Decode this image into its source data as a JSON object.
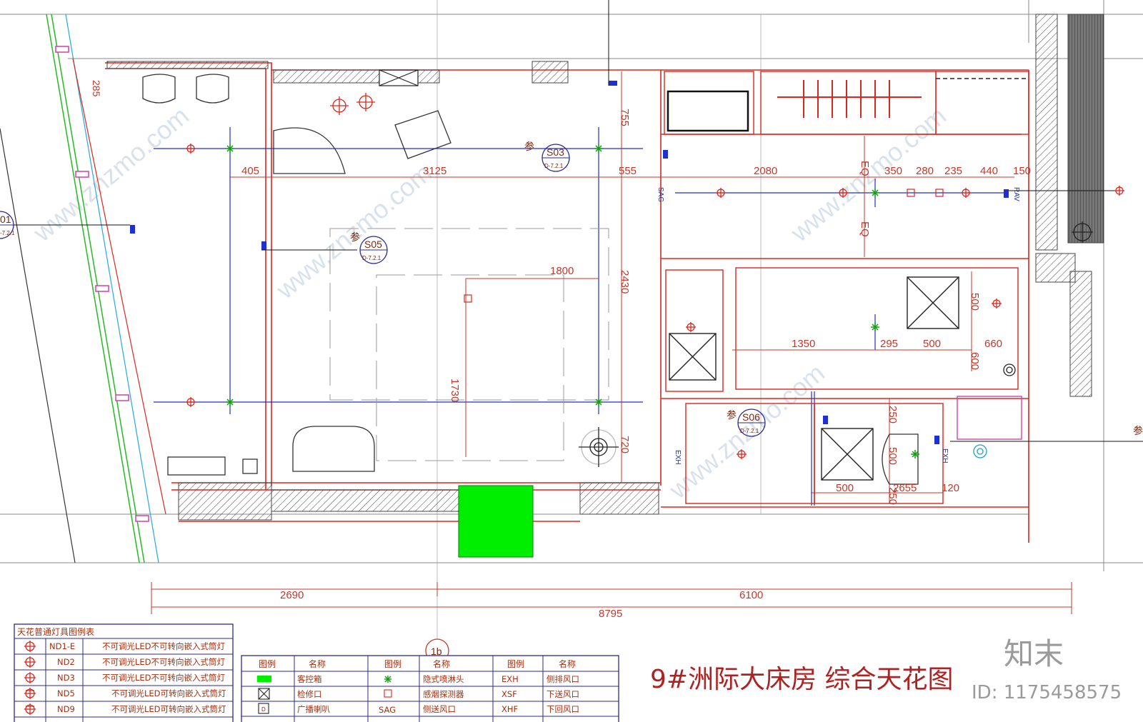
{
  "title": "9#洲际大床房 综合天花图",
  "watermark": {
    "logo": "知末",
    "id": "ID: 1175458575",
    "faint": "www.znzmo.com"
  },
  "dims": {
    "d405": "405",
    "d3125": "3125",
    "d555": "555",
    "d2080": "2080",
    "d350": "350",
    "d280": "280",
    "d235": "235",
    "d440": "440",
    "d150": "150",
    "d755": "755",
    "d2430": "2430",
    "d720": "720",
    "d1800": "1800",
    "d1730": "1730",
    "d1350": "1350",
    "d295": "295",
    "d500a": "500",
    "d660": "660",
    "d500v": "500",
    "d600": "600",
    "d250a": "250",
    "d500b": "500",
    "d250b": "250",
    "d500c": "500",
    "d2655": "2655",
    "d120": "120",
    "d285": "285",
    "eq1": "EQ",
    "eq2": "EQ",
    "b2690": "2690",
    "b6100": "6100",
    "b8795": "8795"
  },
  "tags": {
    "s03": "S03",
    "s03sub": "D-7.2.1",
    "s03pre": "参",
    "s05": "S05",
    "s05sub": "D-7.2.1",
    "s05pre": "参",
    "s06": "S06",
    "s06sub": "D-7.2.1",
    "s06pre": "参",
    "s01": "01",
    "s01sub": "-7.2.1",
    "grid1b": "1b",
    "rightCut": "参"
  },
  "vents": {
    "sag": "SAG",
    "exh1": "EXH",
    "exh2": "EXH",
    "rav": "RAV"
  },
  "lightLegend": {
    "title": "天花普通灯具图例表",
    "rows": [
      {
        "code": "ND1-E",
        "name": "不可调光LED不可转向嵌入式筒灯"
      },
      {
        "code": "ND2",
        "name": "不可调光LED不可转向嵌入式筒灯"
      },
      {
        "code": "ND3",
        "name": "不可调光LED不可转向嵌入式筒灯"
      },
      {
        "code": "ND5",
        "name": "不可调光LED可转向嵌入式筒灯"
      },
      {
        "code": "ND9",
        "name": "不可调光LED可转向嵌入式筒灯"
      }
    ]
  },
  "legend": {
    "headers": [
      "图例",
      "名称",
      "图例",
      "名称",
      "图例",
      "名称"
    ],
    "rows": [
      [
        "客控箱",
        "隐式喷淋头",
        "EXH",
        "侧排风口"
      ],
      [
        "检修口",
        "感烟探测器",
        "XSF",
        "下送风口"
      ],
      [
        "广播喇叭",
        "侧送风口",
        "XHF",
        "下回风口"
      ]
    ],
    "sagCode": "SAG"
  },
  "colors": {
    "wall": "#d8281e",
    "dimension": "#c0392b",
    "blue": "#1f2fd0",
    "green": "#00ee00",
    "title": "#b02222",
    "table": "#2b2b8a"
  }
}
